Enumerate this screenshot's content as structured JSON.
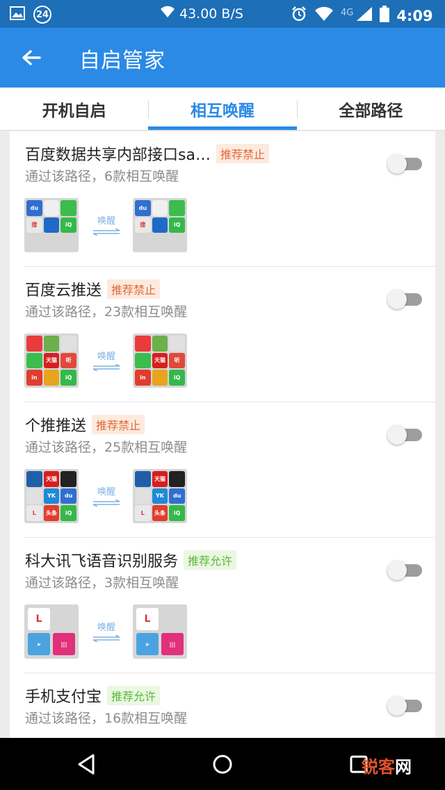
{
  "status_bar": {
    "notification_count": "24",
    "network_speed": "43.00 B/S",
    "network_type": "4G",
    "time": "4:09"
  },
  "app_bar": {
    "title": "自启管家",
    "back_icon": "arrow-left-icon"
  },
  "tabs": [
    {
      "label": "开机自启",
      "active": false
    },
    {
      "label": "相互唤醒",
      "active": true
    },
    {
      "label": "全部路径",
      "active": false
    }
  ],
  "items": [
    {
      "title": "百度数据共享内部接口sa…",
      "badge": "推荐禁止",
      "badge_type": "forbid",
      "subtitle": "通过该路径，6款相互唤醒",
      "toggle_on": false,
      "wake_label": "唤醒",
      "icons": [
        "#2f6fd1",
        "#4a7fd6",
        "#3cbc4c",
        "#e03535",
        "#1f69c7",
        "#35b84a"
      ]
    },
    {
      "title": "百度云推送",
      "badge": "推荐禁止",
      "badge_type": "forbid",
      "subtitle": "通过该路径，23款相互唤醒",
      "toggle_on": false,
      "wake_label": "唤醒",
      "icons": [
        "#e93b3b",
        "#6bb04b",
        "#e0e0e0",
        "#3cbc4c",
        "#d81e1e",
        "#e04a3c",
        "#e03d2d",
        "#e6a51c",
        "#35b84a"
      ]
    },
    {
      "title": "个推推送",
      "badge": "推荐禁止",
      "badge_type": "forbid",
      "subtitle": "通过该路径，25款相互唤醒",
      "toggle_on": false,
      "wake_label": "唤醒",
      "icons": [
        "#1e5fa8",
        "#d81e1e",
        "#222222",
        "#e0e0e0",
        "#1f8ad6",
        "#2f6fd1",
        "#e9e9e9",
        "#e03d2d",
        "#35b84a"
      ]
    },
    {
      "title": "科大讯飞语音识别服务",
      "badge": "推荐允许",
      "badge_type": "allow",
      "subtitle": "通过该路径，3款相互唤醒",
      "toggle_on": false,
      "wake_label": "唤醒",
      "icons": [
        "#ffffff",
        "#d6d6d6",
        "#4aa3e0",
        "#e0317a"
      ]
    },
    {
      "title": "手机支付宝",
      "badge": "推荐允许",
      "badge_type": "allow",
      "subtitle": "通过该路径，16款相互唤醒",
      "toggle_on": false
    }
  ],
  "watermark": {
    "part1": "锐客",
    "part2": "网"
  }
}
